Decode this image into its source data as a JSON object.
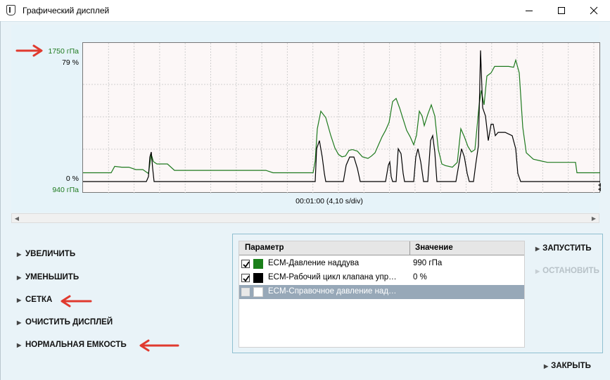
{
  "window": {
    "title": "Графический дисплей",
    "controls": [
      "minimize-icon",
      "maximize-icon",
      "close-icon"
    ]
  },
  "graph": {
    "y_top_primary": "1750 гПа",
    "y_top_secondary": "79 %",
    "y_bottom_secondary": "0 %",
    "y_bottom_primary": "940 гПа",
    "time_label": "00:01:00 (4,10 s/div)",
    "primary_color": "#1f7a1f",
    "secondary_color": "#000000"
  },
  "chart_data": {
    "type": "line",
    "title": "",
    "xlabel": "00:01:00 (4,10 s/div)",
    "grid": true,
    "series": [
      {
        "name": "ECM-Давление наддува",
        "color": "#1f7a1f",
        "unit": "гПа",
        "ylim": [
          940,
          1750
        ],
        "points": [
          [
            0,
            995
          ],
          [
            40,
            995
          ],
          [
            45,
            1035
          ],
          [
            55,
            1030
          ],
          [
            65,
            1030
          ],
          [
            75,
            1015
          ],
          [
            85,
            1015
          ],
          [
            93,
            990
          ],
          [
            97,
            1110
          ],
          [
            100,
            1065
          ],
          [
            105,
            1050
          ],
          [
            120,
            1050
          ],
          [
            130,
            1010
          ],
          [
            140,
            1010
          ],
          [
            260,
            1010
          ],
          [
            270,
            995
          ],
          [
            327,
            995
          ],
          [
            330,
            1070
          ],
          [
            333,
            1270
          ],
          [
            338,
            1380
          ],
          [
            345,
            1340
          ],
          [
            352,
            1230
          ],
          [
            358,
            1150
          ],
          [
            363,
            1110
          ],
          [
            368,
            1095
          ],
          [
            373,
            1100
          ],
          [
            378,
            1135
          ],
          [
            383,
            1140
          ],
          [
            390,
            1130
          ],
          [
            397,
            1095
          ],
          [
            405,
            1085
          ],
          [
            410,
            1100
          ],
          [
            415,
            1120
          ],
          [
            420,
            1170
          ],
          [
            425,
            1220
          ],
          [
            430,
            1260
          ],
          [
            435,
            1310
          ],
          [
            440,
            1440
          ],
          [
            445,
            1460
          ],
          [
            450,
            1400
          ],
          [
            455,
            1330
          ],
          [
            460,
            1260
          ],
          [
            465,
            1220
          ],
          [
            470,
            1170
          ],
          [
            474,
            1230
          ],
          [
            478,
            1380
          ],
          [
            482,
            1350
          ],
          [
            485,
            1290
          ],
          [
            490,
            1360
          ],
          [
            495,
            1420
          ],
          [
            500,
            1350
          ],
          [
            505,
            1140
          ],
          [
            510,
            1050
          ],
          [
            515,
            1040
          ],
          [
            525,
            1030
          ],
          [
            532,
            1060
          ],
          [
            537,
            1270
          ],
          [
            542,
            1220
          ],
          [
            547,
            1160
          ],
          [
            552,
            1125
          ],
          [
            557,
            1140
          ],
          [
            563,
            1420
          ],
          [
            566,
            1510
          ],
          [
            570,
            1420
          ],
          [
            574,
            1600
          ],
          [
            580,
            1620
          ],
          [
            585,
            1660
          ],
          [
            595,
            1660
          ],
          [
            605,
            1660
          ],
          [
            612,
            1655
          ],
          [
            615,
            1700
          ],
          [
            620,
            1620
          ],
          [
            625,
            1280
          ],
          [
            630,
            1120
          ],
          [
            640,
            1080
          ],
          [
            650,
            1070
          ],
          [
            660,
            1060
          ],
          [
            680,
            1060
          ],
          [
            700,
            1060
          ],
          [
            702,
            995
          ],
          [
            735,
            995
          ]
        ]
      },
      {
        "name": "ECM-Рабочий цикл клапана упр…",
        "color": "#000000",
        "unit": "%",
        "ylim": [
          0,
          79
        ],
        "points": [
          [
            0,
            0
          ],
          [
            90,
            0
          ],
          [
            93,
            3
          ],
          [
            95,
            15
          ],
          [
            97,
            18
          ],
          [
            99,
            8
          ],
          [
            101,
            0
          ],
          [
            330,
            0
          ],
          [
            332,
            20
          ],
          [
            336,
            25
          ],
          [
            340,
            15
          ],
          [
            343,
            5
          ],
          [
            345,
            0
          ],
          [
            370,
            0
          ],
          [
            374,
            10
          ],
          [
            379,
            15
          ],
          [
            385,
            15
          ],
          [
            390,
            8
          ],
          [
            394,
            0
          ],
          [
            430,
            0
          ],
          [
            434,
            10
          ],
          [
            436,
            12
          ],
          [
            438,
            3
          ],
          [
            440,
            0
          ],
          [
            445,
            0
          ],
          [
            448,
            20
          ],
          [
            452,
            17
          ],
          [
            455,
            5
          ],
          [
            457,
            0
          ],
          [
            470,
            0
          ],
          [
            473,
            15
          ],
          [
            476,
            20
          ],
          [
            480,
            12
          ],
          [
            484,
            0
          ],
          [
            490,
            0
          ],
          [
            494,
            25
          ],
          [
            497,
            28
          ],
          [
            500,
            18
          ],
          [
            503,
            0
          ],
          [
            530,
            0
          ],
          [
            534,
            10
          ],
          [
            538,
            20
          ],
          [
            542,
            15
          ],
          [
            546,
            5
          ],
          [
            549,
            0
          ],
          [
            555,
            0
          ],
          [
            558,
            10
          ],
          [
            562,
            22
          ],
          [
            565,
            80
          ],
          [
            568,
            45
          ],
          [
            572,
            40
          ],
          [
            576,
            25
          ],
          [
            580,
            35
          ],
          [
            583,
            35
          ],
          [
            586,
            28
          ],
          [
            590,
            30
          ],
          [
            600,
            30
          ],
          [
            610,
            28
          ],
          [
            615,
            20
          ],
          [
            618,
            5
          ],
          [
            622,
            0
          ],
          [
            735,
            0
          ]
        ]
      },
      {
        "name": "ECM-Справочное давление над…",
        "visible": false,
        "points": []
      }
    ]
  },
  "left_buttons": [
    "УВЕЛИЧИТЬ",
    "УМЕНЬШИТЬ",
    "СЕТКА",
    "ОЧИСТИТЬ ДИСПЛЕЙ",
    "НОРМАЛЬНАЯ ЕМКОСТЬ"
  ],
  "table": {
    "col_param": "Параметр",
    "col_value": "Значение",
    "rows": [
      {
        "name": "ECM-Давление наддува",
        "value": "990 гПа",
        "checked": true,
        "color": "#1a7f1a"
      },
      {
        "name": "ECM-Рабочий цикл клапана упр…",
        "value": "0 %",
        "checked": true,
        "color": "#000000"
      },
      {
        "name": "ECM-Справочное давление над…",
        "value": "",
        "checked": false,
        "color": "#ffffff"
      }
    ]
  },
  "right_buttons": {
    "start": "ЗАПУСТИТЬ",
    "stop": "ОСТАНОВИТЬ",
    "close": "ЗАКРЫТЬ"
  },
  "annotations": {
    "arrow_color": "#e03a2f"
  }
}
